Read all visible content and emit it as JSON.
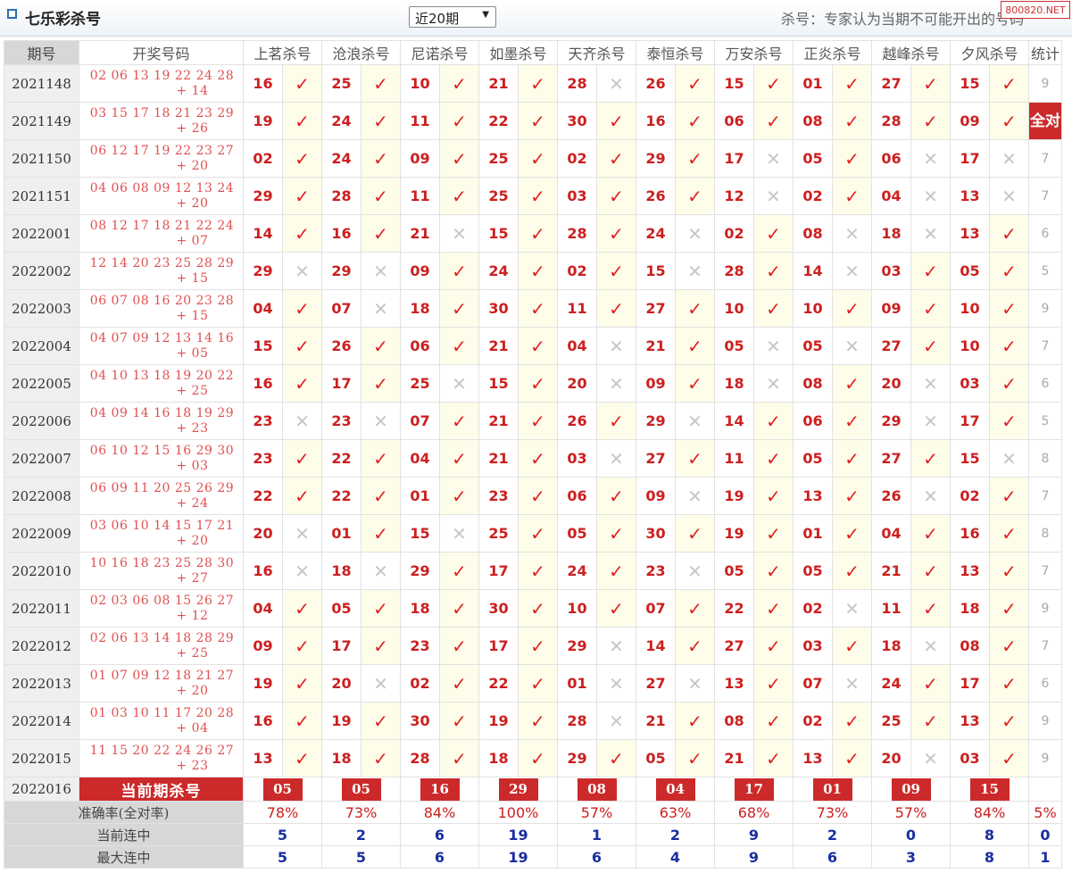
{
  "header": {
    "title": "七乐彩杀号",
    "period_select": "近20期",
    "note": "杀号：专家认为当期不可能开出的号码",
    "brand": "800820.NET"
  },
  "table": {
    "col_period": "期号",
    "col_draw": "开奖号码",
    "experts": [
      "上茗杀号",
      "沧浪杀号",
      "尼诺杀号",
      "如墨杀号",
      "天齐杀号",
      "泰恒杀号",
      "万安杀号",
      "正炎杀号",
      "越峰杀号",
      "夕风杀号"
    ],
    "col_stat": "统计",
    "rows": [
      {
        "period": "2021148",
        "draw": "02 06 13 19 22 24 28",
        "special": "+ 14",
        "kills": [
          "16",
          "25",
          "10",
          "21",
          "28",
          "26",
          "15",
          "01",
          "27",
          "15"
        ],
        "marks": [
          "✓",
          "✓",
          "✓",
          "✓",
          "✕",
          "✓",
          "✓",
          "✓",
          "✓",
          "✓"
        ],
        "stat": "9"
      },
      {
        "period": "2021149",
        "draw": "03 15 17 18 21 23 29",
        "special": "+ 26",
        "kills": [
          "19",
          "24",
          "11",
          "22",
          "30",
          "16",
          "06",
          "08",
          "28",
          "09"
        ],
        "marks": [
          "✓",
          "✓",
          "✓",
          "✓",
          "✓",
          "✓",
          "✓",
          "✓",
          "✓",
          "✓"
        ],
        "stat": "全对"
      },
      {
        "period": "2021150",
        "draw": "06 12 17 19 22 23 27",
        "special": "+ 20",
        "kills": [
          "02",
          "24",
          "09",
          "25",
          "02",
          "29",
          "17",
          "05",
          "06",
          "17"
        ],
        "marks": [
          "✓",
          "✓",
          "✓",
          "✓",
          "✓",
          "✓",
          "✕",
          "✓",
          "✕",
          "✕"
        ],
        "stat": "7"
      },
      {
        "period": "2021151",
        "draw": "04 06 08 09 12 13 24",
        "special": "+ 20",
        "kills": [
          "29",
          "28",
          "11",
          "25",
          "03",
          "26",
          "12",
          "02",
          "04",
          "13"
        ],
        "marks": [
          "✓",
          "✓",
          "✓",
          "✓",
          "✓",
          "✓",
          "✕",
          "✓",
          "✕",
          "✕"
        ],
        "stat": "7"
      },
      {
        "period": "2022001",
        "draw": "08 12 17 18 21 22 24",
        "special": "+ 07",
        "kills": [
          "14",
          "16",
          "21",
          "15",
          "28",
          "24",
          "02",
          "08",
          "18",
          "13"
        ],
        "marks": [
          "✓",
          "✓",
          "✕",
          "✓",
          "✓",
          "✕",
          "✓",
          "✕",
          "✕",
          "✓"
        ],
        "stat": "6"
      },
      {
        "period": "2022002",
        "draw": "12 14 20 23 25 28 29",
        "special": "+ 15",
        "kills": [
          "29",
          "29",
          "09",
          "24",
          "02",
          "15",
          "28",
          "14",
          "03",
          "05"
        ],
        "marks": [
          "✕",
          "✕",
          "✓",
          "✓",
          "✓",
          "✕",
          "✓",
          "✕",
          "✓",
          "✓"
        ],
        "stat": "5"
      },
      {
        "period": "2022003",
        "draw": "06 07 08 16 20 23 28",
        "special": "+ 15",
        "kills": [
          "04",
          "07",
          "18",
          "30",
          "11",
          "27",
          "10",
          "10",
          "09",
          "10"
        ],
        "marks": [
          "✓",
          "✕",
          "✓",
          "✓",
          "✓",
          "✓",
          "✓",
          "✓",
          "✓",
          "✓"
        ],
        "stat": "9"
      },
      {
        "period": "2022004",
        "draw": "04 07 09 12 13 14 16",
        "special": "+ 05",
        "kills": [
          "15",
          "26",
          "06",
          "21",
          "04",
          "21",
          "05",
          "05",
          "27",
          "10"
        ],
        "marks": [
          "✓",
          "✓",
          "✓",
          "✓",
          "✕",
          "✓",
          "✕",
          "✕",
          "✓",
          "✓"
        ],
        "stat": "7"
      },
      {
        "period": "2022005",
        "draw": "04 10 13 18 19 20 22",
        "special": "+ 25",
        "kills": [
          "16",
          "17",
          "25",
          "15",
          "20",
          "09",
          "18",
          "08",
          "20",
          "03"
        ],
        "marks": [
          "✓",
          "✓",
          "✕",
          "✓",
          "✕",
          "✓",
          "✕",
          "✓",
          "✕",
          "✓"
        ],
        "stat": "6"
      },
      {
        "period": "2022006",
        "draw": "04 09 14 16 18 19 29",
        "special": "+ 23",
        "kills": [
          "23",
          "23",
          "07",
          "21",
          "26",
          "29",
          "14",
          "06",
          "29",
          "17"
        ],
        "marks": [
          "✕",
          "✕",
          "✓",
          "✓",
          "✓",
          "✕",
          "✓",
          "✓",
          "✕",
          "✓"
        ],
        "stat": "5"
      },
      {
        "period": "2022007",
        "draw": "06 10 12 15 16 29 30",
        "special": "+ 03",
        "kills": [
          "23",
          "22",
          "04",
          "21",
          "03",
          "27",
          "11",
          "05",
          "27",
          "15"
        ],
        "marks": [
          "✓",
          "✓",
          "✓",
          "✓",
          "✕",
          "✓",
          "✓",
          "✓",
          "✓",
          "✕"
        ],
        "stat": "8"
      },
      {
        "period": "2022008",
        "draw": "06 09 11 20 25 26 29",
        "special": "+ 24",
        "kills": [
          "22",
          "22",
          "01",
          "23",
          "06",
          "09",
          "19",
          "13",
          "26",
          "02"
        ],
        "marks": [
          "✓",
          "✓",
          "✓",
          "✓",
          "✓",
          "✕",
          "✓",
          "✓",
          "✕",
          "✓"
        ],
        "stat": "7"
      },
      {
        "period": "2022009",
        "draw": "03 06 10 14 15 17 21",
        "special": "+ 20",
        "kills": [
          "20",
          "01",
          "15",
          "25",
          "05",
          "30",
          "19",
          "01",
          "04",
          "16"
        ],
        "marks": [
          "✕",
          "✓",
          "✕",
          "✓",
          "✓",
          "✓",
          "✓",
          "✓",
          "✓",
          "✓"
        ],
        "stat": "8"
      },
      {
        "period": "2022010",
        "draw": "10 16 18 23 25 28 30",
        "special": "+ 27",
        "kills": [
          "16",
          "18",
          "29",
          "17",
          "24",
          "23",
          "05",
          "05",
          "21",
          "13"
        ],
        "marks": [
          "✕",
          "✕",
          "✓",
          "✓",
          "✓",
          "✕",
          "✓",
          "✓",
          "✓",
          "✓"
        ],
        "stat": "7"
      },
      {
        "period": "2022011",
        "draw": "02 03 06 08 15 26 27",
        "special": "+ 12",
        "kills": [
          "04",
          "05",
          "18",
          "30",
          "10",
          "07",
          "22",
          "02",
          "11",
          "18"
        ],
        "marks": [
          "✓",
          "✓",
          "✓",
          "✓",
          "✓",
          "✓",
          "✓",
          "✕",
          "✓",
          "✓"
        ],
        "stat": "9"
      },
      {
        "period": "2022012",
        "draw": "02 06 13 14 18 28 29",
        "special": "+ 25",
        "kills": [
          "09",
          "17",
          "23",
          "17",
          "29",
          "14",
          "27",
          "03",
          "18",
          "08"
        ],
        "marks": [
          "✓",
          "✓",
          "✓",
          "✓",
          "✕",
          "✓",
          "✓",
          "✓",
          "✕",
          "✓"
        ],
        "stat": "7"
      },
      {
        "period": "2022013",
        "draw": "01 07 09 12 18 21 27",
        "special": "+ 20",
        "kills": [
          "19",
          "20",
          "02",
          "22",
          "01",
          "27",
          "13",
          "07",
          "24",
          "17"
        ],
        "marks": [
          "✓",
          "✕",
          "✓",
          "✓",
          "✕",
          "✕",
          "✓",
          "✕",
          "✓",
          "✓"
        ],
        "stat": "6"
      },
      {
        "period": "2022014",
        "draw": "01 03 10 11 17 20 28",
        "special": "+ 04",
        "kills": [
          "16",
          "19",
          "30",
          "19",
          "28",
          "21",
          "08",
          "02",
          "25",
          "13"
        ],
        "marks": [
          "✓",
          "✓",
          "✓",
          "✓",
          "✕",
          "✓",
          "✓",
          "✓",
          "✓",
          "✓"
        ],
        "stat": "9"
      },
      {
        "period": "2022015",
        "draw": "11 15 20 22 24 26 27",
        "special": "+ 23",
        "kills": [
          "13",
          "18",
          "28",
          "18",
          "29",
          "05",
          "21",
          "13",
          "20",
          "03"
        ],
        "marks": [
          "✓",
          "✓",
          "✓",
          "✓",
          "✓",
          "✓",
          "✓",
          "✓",
          "✕",
          "✓"
        ],
        "stat": "9"
      }
    ],
    "current": {
      "period": "2022016",
      "label": "当前期杀号",
      "kills": [
        "05",
        "05",
        "16",
        "29",
        "08",
        "04",
        "17",
        "01",
        "09",
        "15"
      ]
    },
    "accuracy": {
      "label": "准确率(全对率)",
      "values": [
        "78%",
        "73%",
        "84%",
        "100%",
        "57%",
        "63%",
        "68%",
        "73%",
        "57%",
        "84%"
      ],
      "total": "5%"
    },
    "current_streak": {
      "label": "当前连中",
      "values": [
        "5",
        "2",
        "6",
        "19",
        "1",
        "2",
        "9",
        "2",
        "0",
        "8"
      ],
      "total": "0"
    },
    "max_streak": {
      "label": "最大连中",
      "values": [
        "5",
        "5",
        "6",
        "19",
        "6",
        "4",
        "9",
        "6",
        "3",
        "8"
      ],
      "total": "1"
    }
  }
}
